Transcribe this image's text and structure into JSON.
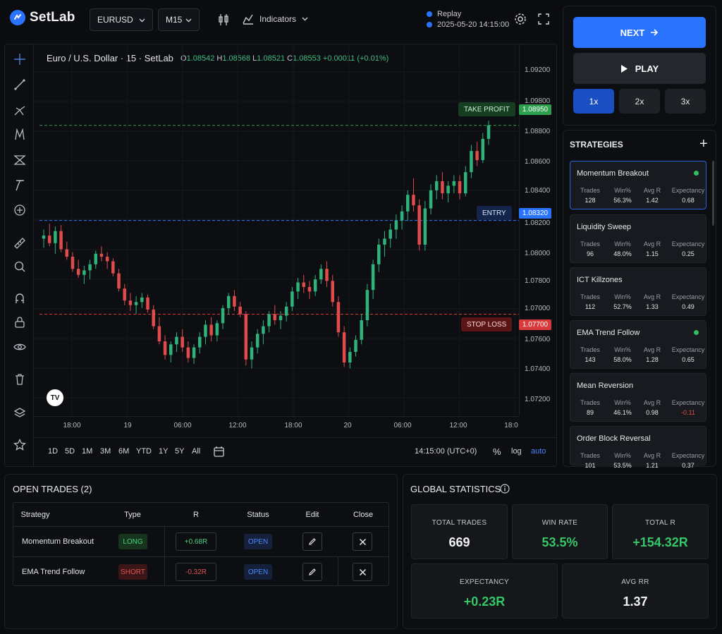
{
  "app": {
    "name": "SetLab"
  },
  "topbar": {
    "symbol": "EURUSD",
    "timeframe": "M15",
    "indicators_label": "Indicators",
    "replay_label": "Replay",
    "replay_time": "2025-05-20 14:15:00"
  },
  "chart": {
    "title": "Euro / U.S. Dollar · 15 · SetLab",
    "ohlc": {
      "o_label": "O",
      "o": "1.08542",
      "h_label": "H",
      "h": "1.08568",
      "l_label": "L",
      "l": "1.08521",
      "c_label": "C",
      "c": "1.08553",
      "change": "+0.00011 (+0.01%)"
    },
    "price_ticks": [
      "1.09200",
      "1.09800",
      "1.08800",
      "1.08600",
      "1.08400",
      "1.08200",
      "1.08000",
      "1.07800",
      "1.07000",
      "1.07600",
      "1.07400",
      "1.07200"
    ],
    "time_ticks": [
      "18:00",
      "19",
      "06:00",
      "12:00",
      "18:00",
      "20",
      "06:00",
      "12:00",
      "18:0"
    ],
    "levels": {
      "take_profit": {
        "label": "TAKE PROFIT",
        "price": "1.08950",
        "color": "#2e9e4f"
      },
      "entry": {
        "label": "ENTRY",
        "price": "1.08320",
        "color": "#2a73ff"
      },
      "stop_loss": {
        "label": "STOP LOSS",
        "price": "1.07700",
        "color": "#d93a3a"
      }
    },
    "watermark": "TV",
    "ranges": [
      "1D",
      "5D",
      "1M",
      "3M",
      "6M",
      "YTD",
      "1Y",
      "5Y",
      "All"
    ],
    "clock": "14:15:00 (UTC+0)",
    "scale_percent": "%",
    "scale_log": "log",
    "scale_auto": "auto",
    "colors": {
      "up": "#2fb37a",
      "down": "#e04b4b"
    }
  },
  "chart_data": {
    "type": "candlestick",
    "candles": [
      [
        1.082,
        1.0826,
        1.0814,
        1.0822
      ],
      [
        1.0822,
        1.083,
        1.0815,
        1.0817
      ],
      [
        1.0817,
        1.0828,
        1.081,
        1.0825
      ],
      [
        1.0825,
        1.0829,
        1.0811,
        1.0813
      ],
      [
        1.0813,
        1.0818,
        1.0806,
        1.0808
      ],
      [
        1.0808,
        1.0811,
        1.0798,
        1.08
      ],
      [
        1.08,
        1.0806,
        1.0794,
        1.0796
      ],
      [
        1.0796,
        1.0802,
        1.079,
        1.0799
      ],
      [
        1.0799,
        1.0806,
        1.0793,
        1.0803
      ],
      [
        1.0803,
        1.0812,
        1.08,
        1.081
      ],
      [
        1.081,
        1.0815,
        1.0805,
        1.0808
      ],
      [
        1.0808,
        1.0811,
        1.08,
        1.0805
      ],
      [
        1.0805,
        1.0807,
        1.0795,
        1.0797
      ],
      [
        1.0797,
        1.08,
        1.0785,
        1.0787
      ],
      [
        1.0787,
        1.079,
        1.0776,
        1.0779
      ],
      [
        1.0779,
        1.0784,
        1.0772,
        1.0776
      ],
      [
        1.0776,
        1.0782,
        1.077,
        1.0778
      ],
      [
        1.0778,
        1.0784,
        1.0774,
        1.0781
      ],
      [
        1.0781,
        1.0783,
        1.0771,
        1.0773
      ],
      [
        1.0773,
        1.0776,
        1.076,
        1.0762
      ],
      [
        1.0762,
        1.0768,
        1.075,
        1.0752
      ],
      [
        1.0752,
        1.0756,
        1.074,
        1.0743
      ],
      [
        1.0743,
        1.0752,
        1.0738,
        1.075
      ],
      [
        1.075,
        1.0758,
        1.0745,
        1.0755
      ],
      [
        1.0755,
        1.076,
        1.0745,
        1.0748
      ],
      [
        1.0748,
        1.0752,
        1.0738,
        1.0741
      ],
      [
        1.0741,
        1.075,
        1.0737,
        1.0748
      ],
      [
        1.0748,
        1.0758,
        1.0744,
        1.0755
      ],
      [
        1.0755,
        1.0766,
        1.075,
        1.0763
      ],
      [
        1.0763,
        1.0768,
        1.0752,
        1.0756
      ],
      [
        1.0756,
        1.0766,
        1.0752,
        1.0764
      ],
      [
        1.0764,
        1.0776,
        1.076,
        1.0774
      ],
      [
        1.0774,
        1.0784,
        1.077,
        1.0782
      ],
      [
        1.0782,
        1.0786,
        1.0772,
        1.0775
      ],
      [
        1.0775,
        1.0778,
        1.0768,
        1.077
      ],
      [
        1.077,
        1.0772,
        1.0736,
        1.074
      ],
      [
        1.074,
        1.0752,
        1.0734,
        1.0748
      ],
      [
        1.0748,
        1.076,
        1.0744,
        1.0757
      ],
      [
        1.0757,
        1.0766,
        1.075,
        1.0762
      ],
      [
        1.0762,
        1.0772,
        1.0758,
        1.077
      ],
      [
        1.077,
        1.0776,
        1.0763,
        1.0766
      ],
      [
        1.0766,
        1.0772,
        1.076,
        1.0769
      ],
      [
        1.0769,
        1.0778,
        1.0765,
        1.0775
      ],
      [
        1.0775,
        1.0788,
        1.0772,
        1.0785
      ],
      [
        1.0785,
        1.0794,
        1.078,
        1.0791
      ],
      [
        1.0791,
        1.0796,
        1.0784,
        1.0788
      ],
      [
        1.0788,
        1.0792,
        1.078,
        1.0785
      ],
      [
        1.0785,
        1.0796,
        1.0782,
        1.0793
      ],
      [
        1.0793,
        1.0803,
        1.079,
        1.08
      ],
      [
        1.08,
        1.0805,
        1.0788,
        1.0792
      ],
      [
        1.0792,
        1.0796,
        1.0775,
        1.0778
      ],
      [
        1.0778,
        1.0782,
        1.0755,
        1.0758
      ],
      [
        1.0758,
        1.0762,
        1.0735,
        1.0738
      ],
      [
        1.0738,
        1.0748,
        1.0734,
        1.0745
      ],
      [
        1.0745,
        1.0756,
        1.0742,
        1.0753
      ],
      [
        1.0753,
        1.077,
        1.075,
        1.0766
      ],
      [
        1.0766,
        1.079,
        1.0762,
        1.0786
      ],
      [
        1.0786,
        1.0806,
        1.078,
        1.0803
      ],
      [
        1.0803,
        1.082,
        1.0798,
        1.0816
      ],
      [
        1.0816,
        1.0825,
        1.0808,
        1.082
      ],
      [
        1.082,
        1.083,
        1.0814,
        1.0826
      ],
      [
        1.0826,
        1.0836,
        1.082,
        1.0832
      ],
      [
        1.0832,
        1.0842,
        1.0826,
        1.0838
      ],
      [
        1.0838,
        1.0852,
        1.0832,
        1.0849
      ],
      [
        1.0849,
        1.086,
        1.0838,
        1.0842
      ],
      [
        1.0842,
        1.0846,
        1.0812,
        1.0816
      ],
      [
        1.0816,
        1.0845,
        1.0812,
        1.084
      ],
      [
        1.084,
        1.0856,
        1.0836,
        1.0852
      ],
      [
        1.0852,
        1.0862,
        1.0846,
        1.0858
      ],
      [
        1.0858,
        1.0864,
        1.0846,
        1.085
      ],
      [
        1.085,
        1.0858,
        1.0844,
        1.0855
      ],
      [
        1.0855,
        1.0862,
        1.085,
        1.0858
      ],
      [
        1.0858,
        1.0862,
        1.0846,
        1.085
      ],
      [
        1.085,
        1.0868,
        1.0848,
        1.0864
      ],
      [
        1.0864,
        1.0882,
        1.086,
        1.0878
      ],
      [
        1.0878,
        1.0884,
        1.0868,
        1.0872
      ],
      [
        1.0872,
        1.089,
        1.087,
        1.0886
      ],
      [
        1.0886,
        1.0898,
        1.0882,
        1.0895
      ]
    ],
    "ylim": [
      1.071,
      1.0935
    ],
    "levels": {
      "take_profit": 1.0895,
      "entry": 1.0832,
      "stop_loss": 1.077
    },
    "grid": true
  },
  "controls": {
    "next_label": "NEXT",
    "play_label": "PLAY",
    "speeds": [
      "1x",
      "2x",
      "3x"
    ]
  },
  "strategies": {
    "title": "STRATEGIES",
    "columns": [
      "Trades",
      "Win%",
      "Avg R",
      "Expectancy"
    ],
    "items": [
      {
        "name": "Momentum Breakout",
        "trades": "128",
        "win": "56.3%",
        "avg_r": "1.42",
        "exp": "0.68"
      },
      {
        "name": "Liquidity Sweep",
        "trades": "96",
        "win": "48.0%",
        "avg_r": "1.15",
        "exp": "0.25"
      },
      {
        "name": "ICT Killzones",
        "trades": "112",
        "win": "52.7%",
        "avg_r": "1.33",
        "exp": "0.49"
      },
      {
        "name": "EMA Trend Follow",
        "trades": "143",
        "win": "58.0%",
        "avg_r": "1.28",
        "exp": "0.65"
      },
      {
        "name": "Mean Reversion",
        "trades": "89",
        "win": "46.1%",
        "avg_r": "0.98",
        "exp": "-0.11"
      },
      {
        "name": "Order Block Reversal",
        "trades": "101",
        "win": "53.5%",
        "avg_r": "1.21",
        "exp": "0.37"
      }
    ]
  },
  "open_trades": {
    "title": "OPEN TRADES (2)",
    "headers": [
      "Strategy",
      "Type",
      "R",
      "Status",
      "Edit",
      "Close"
    ],
    "rows": [
      {
        "strategy": "Momentum Breakout",
        "type": "LONG",
        "r": "+0.68R",
        "status": "OPEN"
      },
      {
        "strategy": "EMA Trend Follow",
        "type": "SHORT",
        "r": "-0.32R",
        "status": "OPEN"
      }
    ]
  },
  "global_stats": {
    "title": "GLOBAL STATISTICS",
    "total_trades_label": "TOTAL TRADES",
    "total_trades": "669",
    "win_rate_label": "WIN RATE",
    "win_rate": "53.5%",
    "total_r_label": "TOTAL R",
    "total_r": "+154.32R",
    "expectancy_label": "EXPECTANCY",
    "expectancy": "+0.23R",
    "avg_rr_label": "AVG RR",
    "avg_rr": "1.37"
  }
}
